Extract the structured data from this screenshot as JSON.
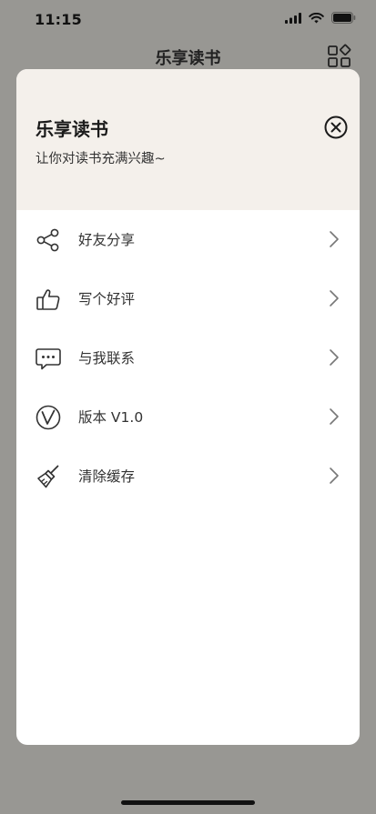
{
  "status_bar": {
    "time": "11:15"
  },
  "nav": {
    "title": "乐享读书",
    "icon": "grid-icon"
  },
  "sheet": {
    "title": "乐享读书",
    "subtitle": "让你对读书充满兴趣~",
    "close_icon": "close-circle-icon",
    "header_bg": "#f4f0eb"
  },
  "menu": {
    "items": [
      {
        "label": "好友分享",
        "icon": "share-icon"
      },
      {
        "label": "写个好评",
        "icon": "thumbs-up-icon"
      },
      {
        "label": "与我联系",
        "icon": "message-icon"
      },
      {
        "label": "版本 V1.0",
        "icon": "version-icon"
      },
      {
        "label": "清除缓存",
        "icon": "broom-icon"
      }
    ]
  },
  "colors": {
    "backdrop": "#989793",
    "sheet": "#ffffff",
    "text": "#333333"
  }
}
